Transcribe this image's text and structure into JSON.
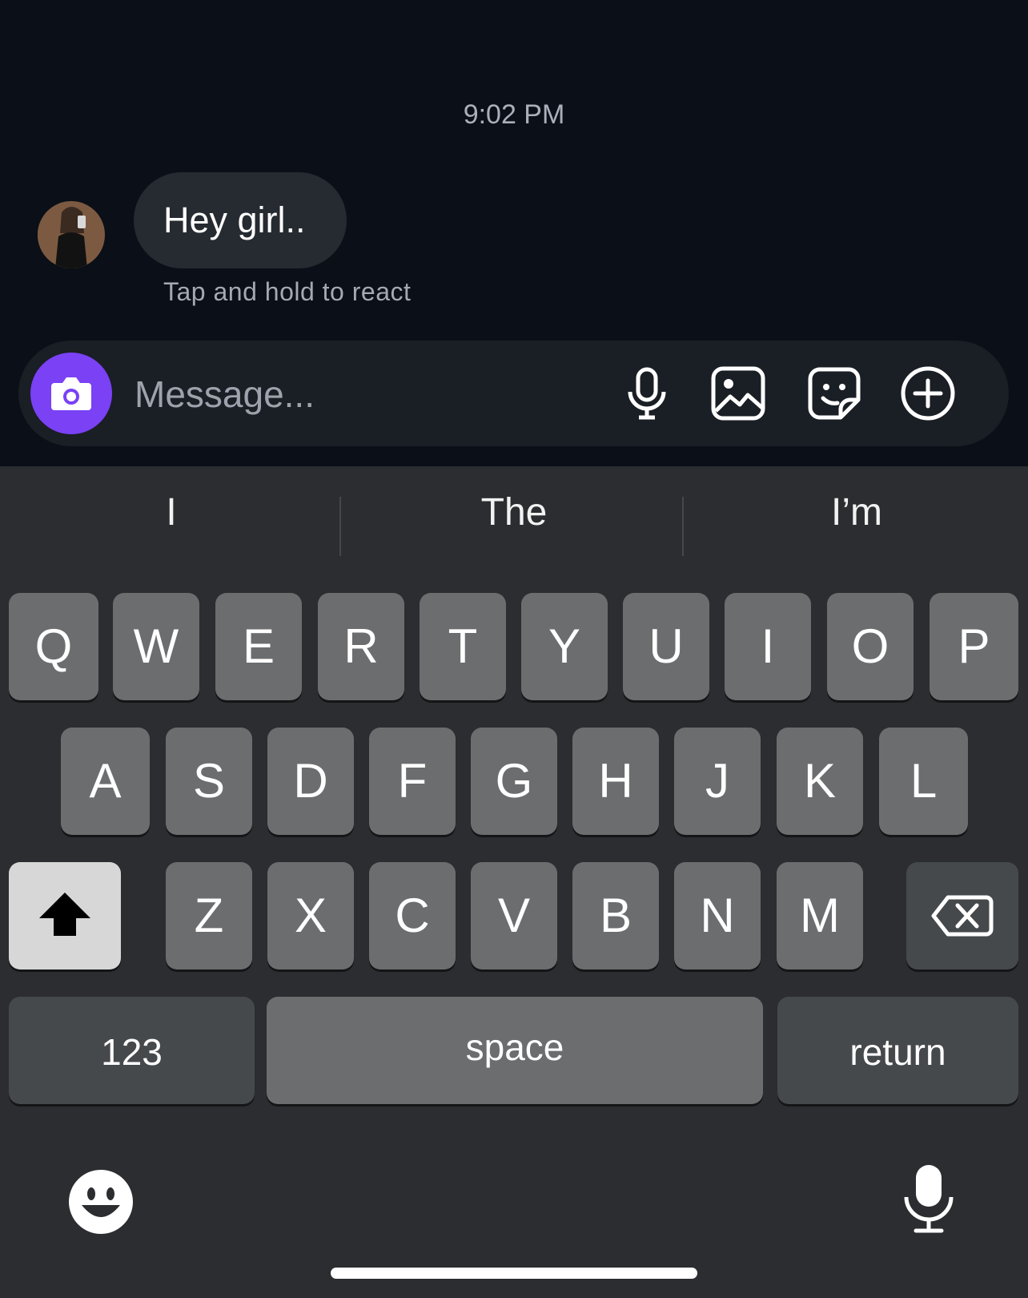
{
  "chat": {
    "timestamp": "9:02 PM",
    "message": "Hey girl..",
    "react_hint": "Tap and hold to react"
  },
  "composer": {
    "placeholder": "Message...",
    "accent_color": "#7a41f5",
    "icons": [
      "camera-icon",
      "microphone-icon",
      "gallery-icon",
      "sticker-icon",
      "add-icon"
    ]
  },
  "keyboard": {
    "suggestions": [
      "I",
      "The",
      "I’m"
    ],
    "row1": [
      "Q",
      "W",
      "E",
      "R",
      "T",
      "Y",
      "U",
      "I",
      "O",
      "P"
    ],
    "row2": [
      "A",
      "S",
      "D",
      "F",
      "G",
      "H",
      "J",
      "K",
      "L"
    ],
    "row3": [
      "Z",
      "X",
      "C",
      "V",
      "B",
      "N",
      "M"
    ],
    "numbers_label": "123",
    "space_label": "space",
    "return_label": "return",
    "icons": [
      "shift-icon",
      "backspace-icon",
      "emoji-icon",
      "dictation-icon"
    ]
  }
}
